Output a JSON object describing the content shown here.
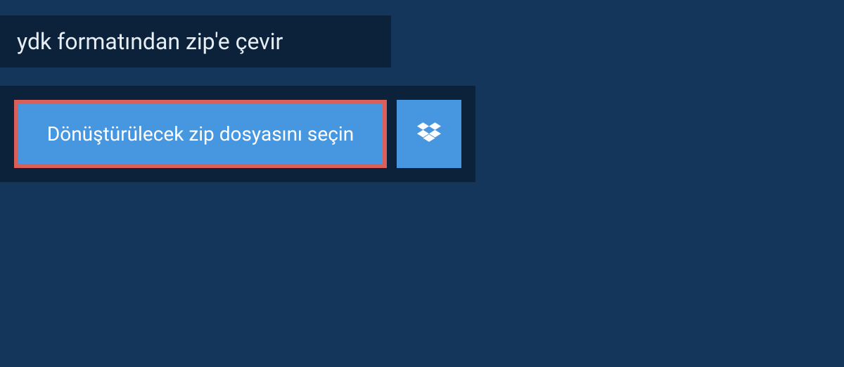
{
  "header": {
    "title": "ydk formatından zip'e çevir"
  },
  "upload": {
    "select_label": "Dönüştürülecek zip dosyasını seçin"
  }
}
